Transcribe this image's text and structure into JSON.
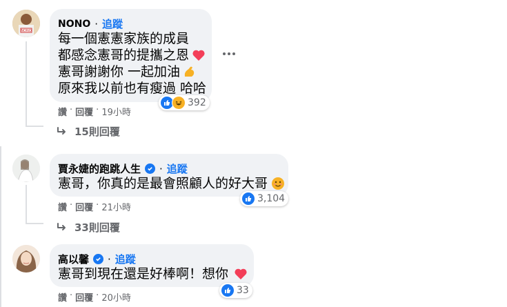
{
  "comments": [
    {
      "author": "NONO",
      "follow": "追蹤",
      "lines": [
        "每一個憲憲家族的成員",
        "都感念憲哥的提攜之恩",
        "憲哥謝謝你 一起加油",
        "原來我以前也有瘦過 哈哈"
      ],
      "reaction_count": "392",
      "actions": {
        "like": "讚",
        "sep": "·",
        "reply": "回覆",
        "time": "19小時"
      },
      "replies": "15則回覆",
      "avatar_text": "NONO"
    },
    {
      "author": "賈永婕的跑跳人生",
      "follow": "追蹤",
      "lines": [
        "憲哥，你真的是最會照顧人的好大哥"
      ],
      "reaction_count": "3,104",
      "actions": {
        "like": "讚",
        "sep": "·",
        "reply": "回覆",
        "time": "21小時"
      },
      "replies": "33則回覆"
    },
    {
      "author": "高以馨",
      "follow": "追蹤",
      "lines": [
        "憲哥到現在還是好棒啊！想你"
      ],
      "reaction_count": "33",
      "actions": {
        "like": "讚",
        "sep": "·",
        "reply": "回覆",
        "time": "20小時"
      }
    }
  ],
  "colors": {
    "bubble": "#f0f2f5",
    "link": "#1877f2",
    "meta": "#65676b",
    "heart": "#f33e58",
    "like": "#1877f2",
    "haha": "#f7b125"
  },
  "icons": [
    "like-icon",
    "haha-icon",
    "heart-icon",
    "flexed-biceps-icon",
    "smiling-face-icon",
    "verified-badge-icon",
    "reply-arrow-icon"
  ]
}
